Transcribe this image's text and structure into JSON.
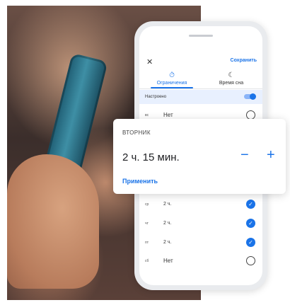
{
  "header": {
    "close_icon": "close-icon",
    "save_label": "Сохранить"
  },
  "tabs": [
    {
      "label": "Ограничения",
      "icon": "timer-icon",
      "active": true
    },
    {
      "label": "Время сна",
      "icon": "moon-icon",
      "active": false
    }
  ],
  "toggle": {
    "label": "Настроено",
    "on": true
  },
  "days_top": [
    {
      "day": "вс",
      "value": "Нет",
      "checked": false
    }
  ],
  "dialog": {
    "title": "ВТОРНИК",
    "value": "2 ч. 15 мин.",
    "minus_symbol": "−",
    "plus_symbol": "+",
    "apply_label": "Применить"
  },
  "days_bottom": [
    {
      "day": "ср",
      "value": "2 ч.",
      "checked": true
    },
    {
      "day": "чт",
      "value": "2 ч.",
      "checked": true
    },
    {
      "day": "пт",
      "value": "2 ч.",
      "checked": true
    },
    {
      "day": "сб",
      "value": "Нет",
      "checked": false
    }
  ],
  "colors": {
    "accent": "#1a73e8",
    "accent_light": "#e8f0fe"
  }
}
